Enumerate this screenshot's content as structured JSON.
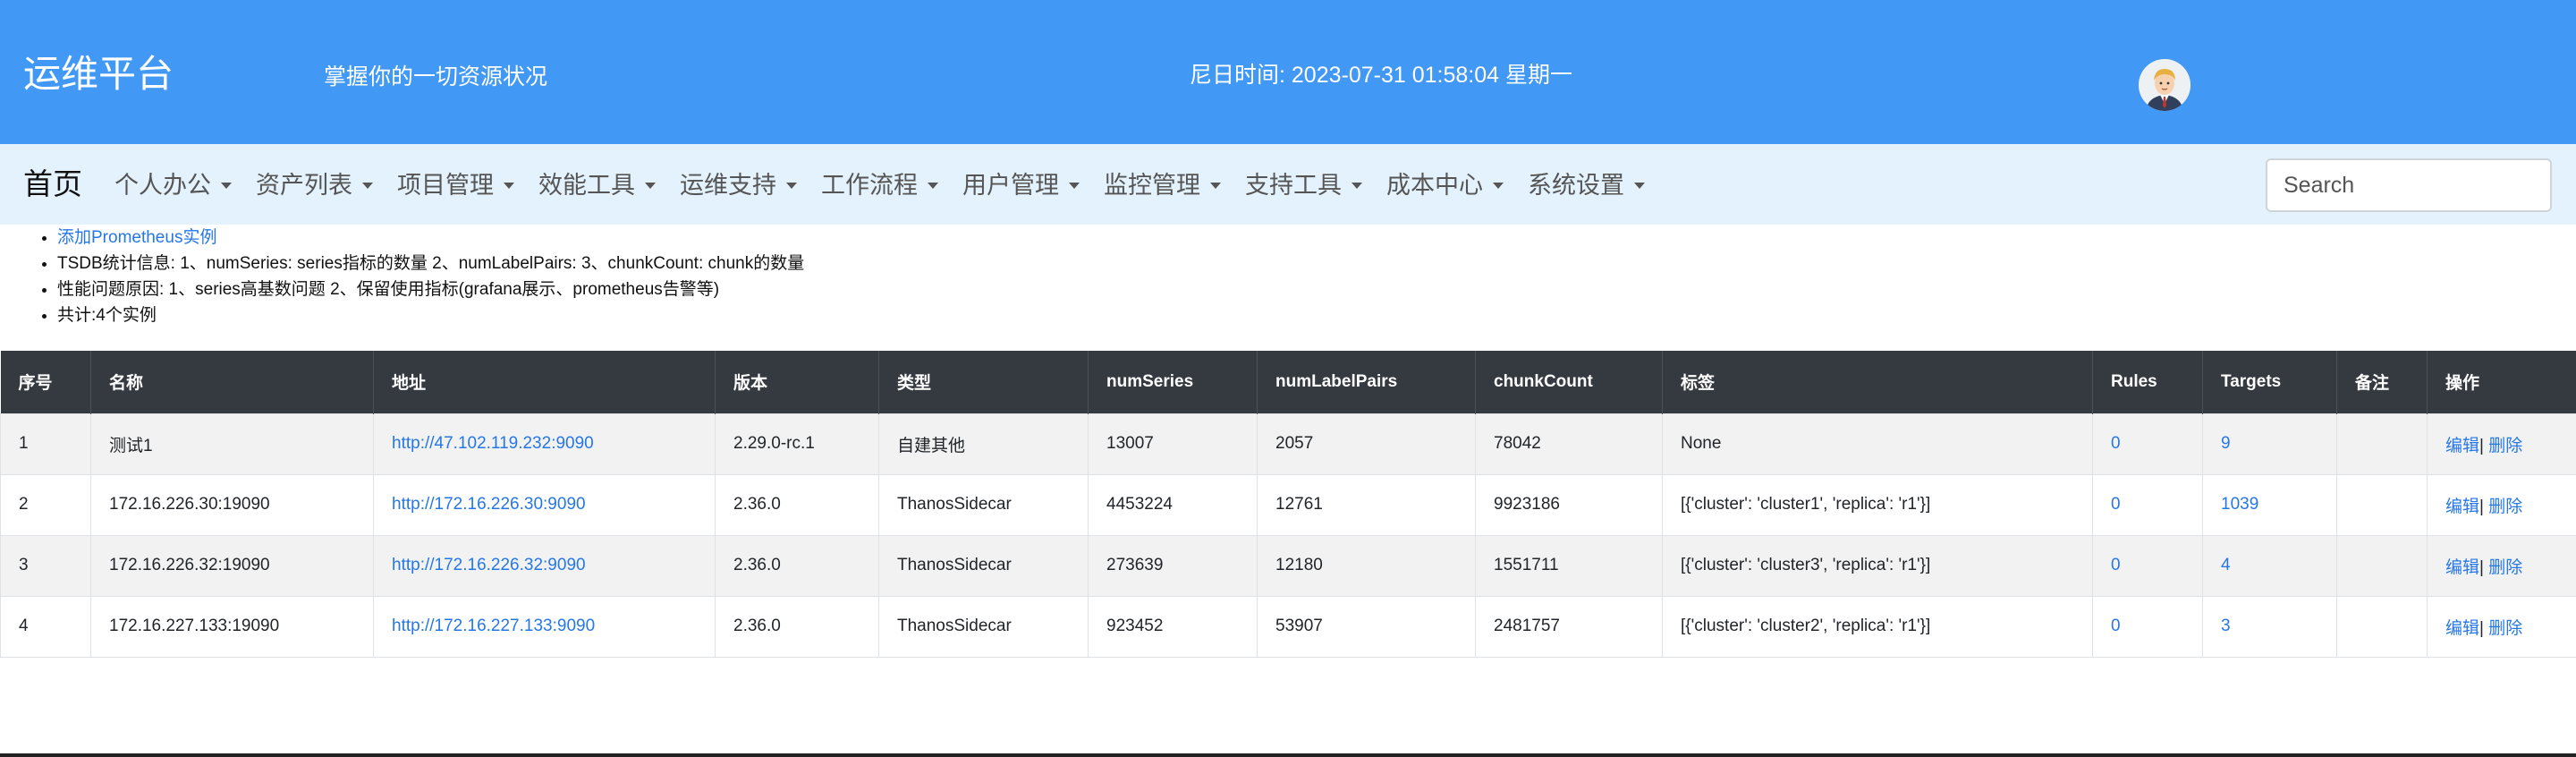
{
  "header": {
    "brand": "运维平台",
    "slogan": "掌握你的一切资源状况",
    "clock": "尼日时间: 2023-07-31 01:58:04 星期一",
    "avatar_icon": "user-avatar-icon",
    "color": "#4298f5"
  },
  "navbar": {
    "home": "首页",
    "items": [
      {
        "label": "个人办公"
      },
      {
        "label": "资产列表"
      },
      {
        "label": "项目管理"
      },
      {
        "label": "效能工具"
      },
      {
        "label": "运维支持"
      },
      {
        "label": "工作流程"
      },
      {
        "label": "用户管理"
      },
      {
        "label": "监控管理"
      },
      {
        "label": "支持工具"
      },
      {
        "label": "成本中心"
      },
      {
        "label": "系统设置"
      }
    ],
    "search_placeholder": "Search"
  },
  "info": {
    "add_link": "添加Prometheus实例",
    "tsdb": "TSDB统计信息: 1、numSeries: series指标的数量 2、numLabelPairs: 3、chunkCount: chunk的数量",
    "perf": "性能问题原因: 1、series高基数问题 2、保留使用指标(grafana展示、prometheus告警等)",
    "total": "共计:4个实例"
  },
  "table": {
    "headers": [
      "序号",
      "名称",
      "地址",
      "版本",
      "类型",
      "numSeries",
      "numLabelPairs",
      "chunkCount",
      "标签",
      "Rules",
      "Targets",
      "备注",
      "操作"
    ],
    "rows": [
      {
        "idx": "1",
        "name": "测试1",
        "addr": "http://47.102.119.232:9090",
        "version": "2.29.0-rc.1",
        "type": "自建其他",
        "numSeries": "13007",
        "numLabelPairs": "2057",
        "chunkCount": "78042",
        "labels": "None",
        "rules": "0",
        "targets": "9",
        "note": "",
        "edit": "编辑",
        "sep": "|",
        "del": "删除"
      },
      {
        "idx": "2",
        "name": "172.16.226.30:19090",
        "addr": "http://172.16.226.30:9090",
        "version": "2.36.0",
        "type": "ThanosSidecar",
        "numSeries": "4453224",
        "numLabelPairs": "12761",
        "chunkCount": "9923186",
        "labels": "[{'cluster': 'cluster1', 'replica': 'r1'}]",
        "rules": "0",
        "targets": "1039",
        "note": "",
        "edit": "编辑",
        "sep": "|",
        "del": "删除"
      },
      {
        "idx": "3",
        "name": "172.16.226.32:19090",
        "addr": "http://172.16.226.32:9090",
        "version": "2.36.0",
        "type": "ThanosSidecar",
        "numSeries": "273639",
        "numLabelPairs": "12180",
        "chunkCount": "1551711",
        "labels": "[{'cluster': 'cluster3', 'replica': 'r1'}]",
        "rules": "0",
        "targets": "4",
        "note": "",
        "edit": "编辑",
        "sep": "|",
        "del": "删除"
      },
      {
        "idx": "4",
        "name": "172.16.227.133:19090",
        "addr": "http://172.16.227.133:9090",
        "version": "2.36.0",
        "type": "ThanosSidecar",
        "numSeries": "923452",
        "numLabelPairs": "53907",
        "chunkCount": "2481757",
        "labels": "[{'cluster': 'cluster2', 'replica': 'r1'}]",
        "rules": "0",
        "targets": "3",
        "note": "",
        "edit": "编辑",
        "sep": "|",
        "del": "删除"
      }
    ]
  }
}
